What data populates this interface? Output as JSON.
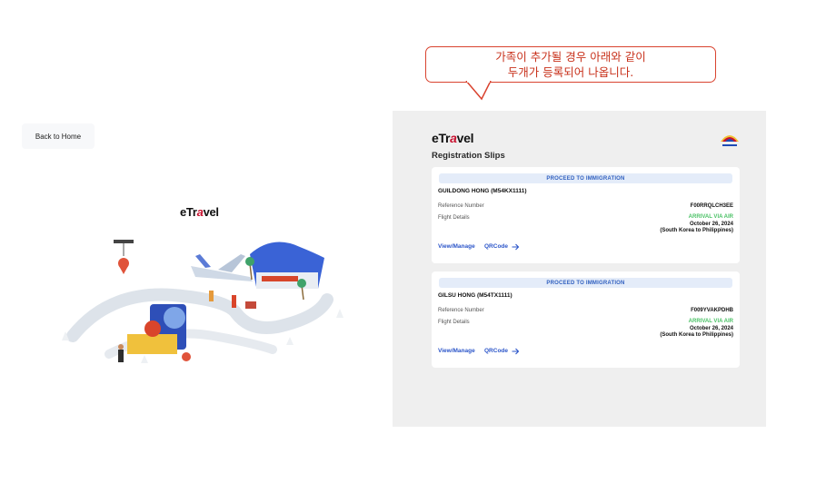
{
  "left": {
    "back_button_label": "Back to Home",
    "logo": {
      "prefix": "eTr",
      "accent": "a",
      "suffix": "vel"
    }
  },
  "callout": {
    "line1": "가족이 추가될 경우 아래와 같이",
    "line2": "두개가 등록되어 나옵니다.",
    "border_color": "#d9432f"
  },
  "panel": {
    "logo": {
      "prefix": "eTr",
      "accent": "a",
      "suffix": "vel"
    },
    "title": "Registration Slips",
    "emblem_icon": "bagong-pilipinas-emblem-icon",
    "slips": [
      {
        "status": "PROCEED TO IMMIGRATION",
        "traveler": "GUILDONG HONG (M54KX1111)",
        "reference_label": "Reference Number",
        "reference_number": "F00RRQLCH3EE",
        "flight_label": "Flight Details",
        "flight_mode": "ARRIVAL VIA AIR",
        "flight_date": "October 26, 2024",
        "flight_route": "(South Korea to Philippines)",
        "view_manage_label": "View/Manage",
        "qrcode_label": "QRCode"
      },
      {
        "status": "PROCEED TO IMMIGRATION",
        "traveler": "GILSU HONG (M54TX1111)",
        "reference_label": "Reference Number",
        "reference_number": "F009YVAKPDHB",
        "flight_label": "Flight Details",
        "flight_mode": "ARRIVAL VIA AIR",
        "flight_date": "October 26, 2024",
        "flight_route": "(South Korea to Philippines)",
        "view_manage_label": "View/Manage",
        "qrcode_label": "QRCode"
      }
    ]
  },
  "colors": {
    "link": "#2b55c9",
    "status_text": "#2f5fbf",
    "status_bg": "#e4ecf9",
    "arrival": "#4cc267",
    "panel_bg": "#efefef"
  }
}
